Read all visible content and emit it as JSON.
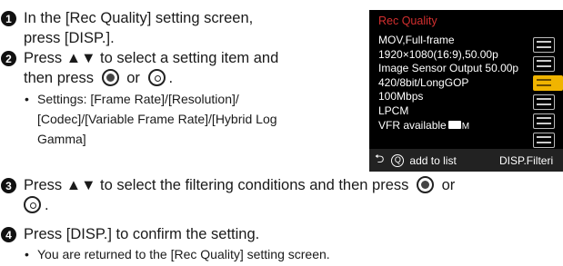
{
  "steps": [
    {
      "num": "1",
      "line1": "In the [Rec Quality] setting screen,",
      "line2": "press [DISP.]."
    },
    {
      "num": "2",
      "line1": "Press ▲▼ to select a setting item and",
      "line2_prefix": "then press",
      "line2_mid": "or",
      "line2_suffix": "."
    },
    {
      "num": "3",
      "line1_prefix": "Press ▲▼ to select the filtering conditions and then press",
      "line1_suffix": "or",
      "line2_suffix": "."
    },
    {
      "num": "4",
      "line1": "Press [DISP.] to confirm the setting."
    }
  ],
  "notes": {
    "settings_line1": "Settings: [Frame Rate]/[Resolution]/",
    "settings_line2": "[Codec]/[Variable Frame Rate]/[Hybrid Log",
    "settings_line3": "Gamma]",
    "return": "You are returned to the [Rec Quality] setting screen."
  },
  "camera_screen": {
    "title": "Rec Quality",
    "items": [
      "MOV,Full-frame",
      "1920×1080(16:9),50.00p",
      "Image Sensor Output 50.00p",
      "420/8bit/LongGOP",
      "100Mbps",
      "LPCM",
      "VFR available"
    ],
    "vfr_icon": "camera-m-icon",
    "footer_left": "add to list",
    "footer_right": "DISP.Filteri",
    "colors": {
      "title": "#d32f2f",
      "selected": "#f0b400",
      "background": "#000000"
    }
  }
}
